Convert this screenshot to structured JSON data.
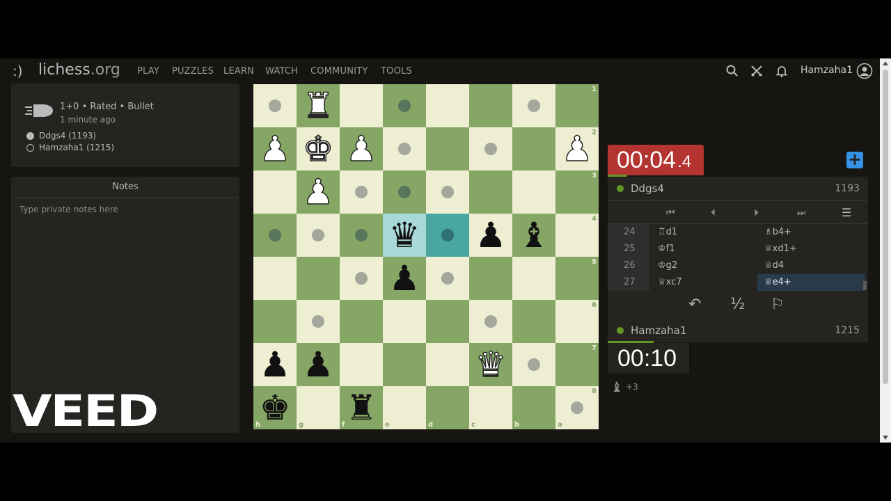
{
  "header": {
    "logo_smile": ":)",
    "logo_name": "lichess",
    "logo_tld": ".org",
    "nav": [
      "PLAY",
      "PUZZLES",
      "LEARN",
      "WATCH",
      "COMMUNITY",
      "TOOLS"
    ],
    "username": "Hamzaha1"
  },
  "game_info": {
    "title": "1+0 • Rated • Bullet",
    "time_ago": "1 minute ago",
    "players": [
      {
        "name": "Ddgs4 (1193)",
        "color": "black"
      },
      {
        "name": "Hamzaha1 (1215)",
        "color": "white"
      }
    ]
  },
  "notes": {
    "title": "Notes",
    "placeholder": "Type private notes here"
  },
  "watermark": "VEED",
  "board": {
    "orientation": "black",
    "ranks": [
      "1",
      "2",
      "3",
      "4",
      "5",
      "6",
      "7",
      "8"
    ],
    "files": [
      "h",
      "g",
      "f",
      "e",
      "d",
      "c",
      "b",
      "a"
    ],
    "rows": [
      [
        "",
        "wR",
        "",
        "",
        "",
        "",
        "",
        ""
      ],
      [
        "wP",
        "wK",
        "wP",
        "",
        "",
        "",
        "",
        "wP"
      ],
      [
        "",
        "wP",
        "",
        "",
        "",
        "",
        "",
        ""
      ],
      [
        "",
        "",
        "",
        "bQ",
        "",
        "bP",
        "bB",
        ""
      ],
      [
        "",
        "",
        "",
        "bP",
        "",
        "",
        "",
        ""
      ],
      [
        "",
        "",
        "",
        "",
        "",
        "",
        "",
        ""
      ],
      [
        "bP",
        "bP",
        "",
        "",
        "",
        "wQ",
        "",
        ""
      ],
      [
        "bK",
        "",
        "bR",
        "",
        "",
        "",
        "",
        ""
      ]
    ],
    "move_dots": [
      [
        0,
        0
      ],
      [
        0,
        3
      ],
      [
        0,
        6
      ],
      [
        1,
        3
      ],
      [
        1,
        5
      ],
      [
        2,
        2
      ],
      [
        2,
        3
      ],
      [
        2,
        4
      ],
      [
        3,
        0
      ],
      [
        3,
        1
      ],
      [
        3,
        2
      ],
      [
        3,
        4
      ],
      [
        4,
        2
      ],
      [
        4,
        4
      ],
      [
        5,
        1
      ],
      [
        5,
        5
      ],
      [
        6,
        6
      ],
      [
        7,
        7
      ]
    ],
    "highlight": [
      [
        3,
        3
      ],
      [
        3,
        4
      ]
    ]
  },
  "opponent": {
    "clock_main": "00:04",
    "clock_tenth": ".4",
    "name": "Ddgs4",
    "rating": "1193"
  },
  "player": {
    "clock": "00:10",
    "name": "Hamzaha1",
    "rating": "1215",
    "material": "+3"
  },
  "moves": [
    {
      "num": "24",
      "white": "♖d1",
      "black": "♗b4+"
    },
    {
      "num": "25",
      "white": "♔f1",
      "black": "♕xd1+"
    },
    {
      "num": "26",
      "white": "♔g2",
      "black": "♕d4"
    },
    {
      "num": "27",
      "white": "♕xc7",
      "black": "♕e4+",
      "active": true
    }
  ],
  "actions": {
    "takeback": "↶",
    "draw": "½",
    "resign": "⚐"
  }
}
